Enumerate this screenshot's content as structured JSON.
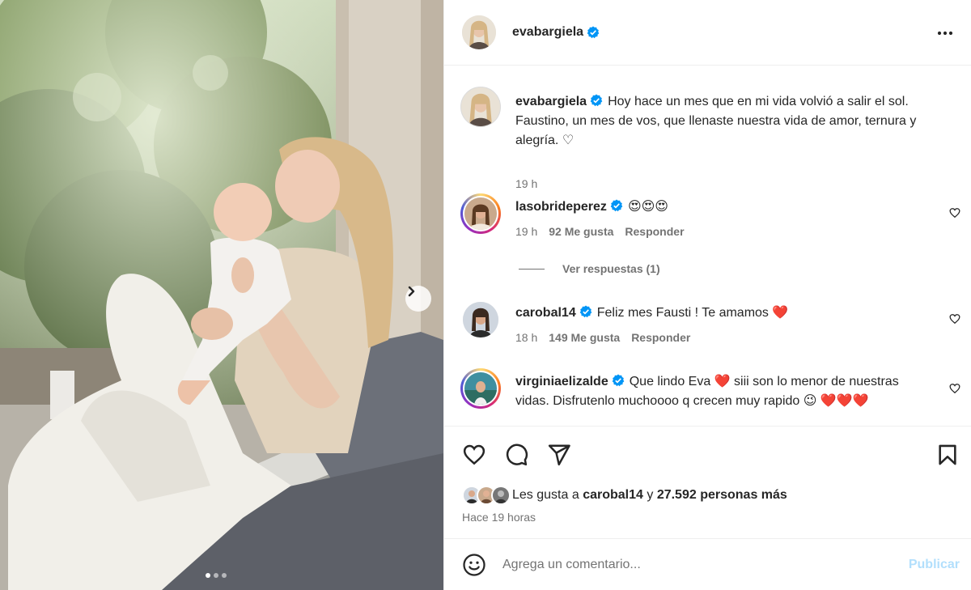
{
  "post": {
    "username": "evabargiela",
    "more_icon": "more-horizontal-icon",
    "carousel": {
      "slide_count": 3,
      "active_slide": 1
    }
  },
  "caption": {
    "username": "evabargiela",
    "text": "Hoy hace un mes que en mi vida volvió a salir el sol. Faustino, un mes de vos, que llenaste nuestra vida de amor, ternura y alegría. ♡",
    "time": "19 h"
  },
  "comments": [
    {
      "username": "lasobrideperez",
      "text": "😍😍😍",
      "time": "19 h",
      "likes": "92 Me gusta",
      "reply": "Responder"
    },
    {
      "username": "carobal14",
      "text": "Feliz mes Fausti ! Te amamos ❤️",
      "time": "18 h",
      "likes": "149 Me gusta",
      "reply": "Responder"
    },
    {
      "username": "virginiaelizalde",
      "text": "Que lindo Eva ❤️ siii son lo menor de nuestras vidas. Disfrutenlo muchoooo q crecen muy rapido 😉 ❤️❤️❤️"
    }
  ],
  "view_replies": "Ver respuestas (1)",
  "likes": {
    "prefix": "Les gusta a",
    "user": "carobal14",
    "connector": "y",
    "count": "27.592 personas más"
  },
  "posted_ago": "Hace 19 horas",
  "composer": {
    "placeholder": "Agrega un comentario...",
    "post_label": "Publicar"
  },
  "colors": {
    "verified": "#0095f6",
    "heart_red": "#ed4956",
    "post_disabled": "#b2dffc"
  }
}
